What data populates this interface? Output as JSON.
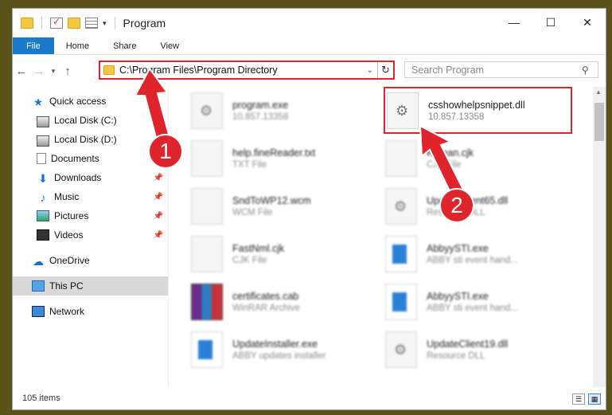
{
  "window": {
    "title": "Program"
  },
  "ribbon": {
    "tabs": [
      "File",
      "Home",
      "Share",
      "View"
    ]
  },
  "address": {
    "path": "C:\\Program Files\\Program Directory"
  },
  "search": {
    "placeholder": "Search Program"
  },
  "sidebar": {
    "items": [
      {
        "label": "Quick access",
        "icon": "star-icon"
      },
      {
        "label": "Local Disk (C:)",
        "icon": "drive-icon"
      },
      {
        "label": "Local Disk (D:)",
        "icon": "drive-icon"
      },
      {
        "label": "Documents",
        "icon": "documents-icon"
      },
      {
        "label": "Downloads",
        "icon": "download-icon"
      },
      {
        "label": "Music",
        "icon": "music-icon"
      },
      {
        "label": "Pictures",
        "icon": "pictures-icon"
      },
      {
        "label": "Videos",
        "icon": "videos-icon"
      },
      {
        "label": "OneDrive",
        "icon": "cloud-icon"
      },
      {
        "label": "This PC",
        "icon": "computer-icon"
      },
      {
        "label": "Network",
        "icon": "network-icon"
      }
    ]
  },
  "files": [
    {
      "name": "program.exe",
      "desc": "10.857.13358"
    },
    {
      "name": "csshowhelpsnippet.dll",
      "desc": "10.857.13358"
    },
    {
      "name": "help.fineReader.txt",
      "desc": "TXT File"
    },
    {
      "name": "Korean.cjk",
      "desc": "CJK File"
    },
    {
      "name": "SndToWP12.wcm",
      "desc": "WCM File"
    },
    {
      "name": "UpdateClient65.dll",
      "desc": "Resource DLL"
    },
    {
      "name": "FastNml.cjk",
      "desc": "CJK File"
    },
    {
      "name": "AbbyySTI.exe",
      "desc": "ABBY sti event hand..."
    },
    {
      "name": "certificates.cab",
      "desc": "WinRAR Archive"
    },
    {
      "name": "AbbyySTI.exe",
      "desc": "ABBY sti event hand..."
    },
    {
      "name": "UpdateInstaller.exe",
      "desc": "ABBY updates installer"
    },
    {
      "name": "UpdateClient19.dll",
      "desc": "Resource DLL"
    }
  ],
  "status": {
    "count": "105 items"
  },
  "annotations": {
    "step1": "1",
    "step2": "2",
    "color": "#e0242c"
  }
}
